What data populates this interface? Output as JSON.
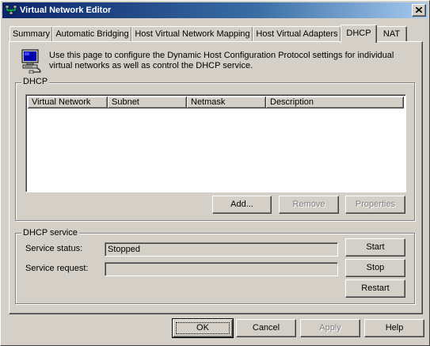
{
  "window": {
    "title": "Virtual Network Editor",
    "close_icon": "close-icon",
    "app_icon": "network-icon"
  },
  "tabs": [
    {
      "label": "Summary",
      "active": false
    },
    {
      "label": "Automatic Bridging",
      "active": false
    },
    {
      "label": "Host Virtual Network Mapping",
      "active": false
    },
    {
      "label": "Host Virtual Adapters",
      "active": false
    },
    {
      "label": "DHCP",
      "active": true
    },
    {
      "label": "NAT",
      "active": false
    }
  ],
  "intro": {
    "icon": "computer-network-icon",
    "text": "Use this page to configure the Dynamic Host Configuration Protocol settings for individual virtual networks as well as control the DHCP service."
  },
  "dhcp_group": {
    "label": "DHCP",
    "columns": [
      "Virtual Network",
      "Subnet",
      "Netmask",
      "Description"
    ],
    "rows": [],
    "buttons": {
      "add": "Add...",
      "remove": "Remove",
      "properties": "Properties"
    }
  },
  "service_group": {
    "label": "DHCP service",
    "status_label": "Service status:",
    "status_value": "Stopped",
    "request_label": "Service request:",
    "request_value": "",
    "buttons": {
      "start": "Start",
      "stop": "Stop",
      "restart": "Restart"
    }
  },
  "footer": {
    "ok": "OK",
    "cancel": "Cancel",
    "apply": "Apply",
    "help": "Help"
  },
  "colors": {
    "face": "#d4d0c8",
    "title_start": "#0a246a",
    "title_end": "#a6caf0"
  }
}
